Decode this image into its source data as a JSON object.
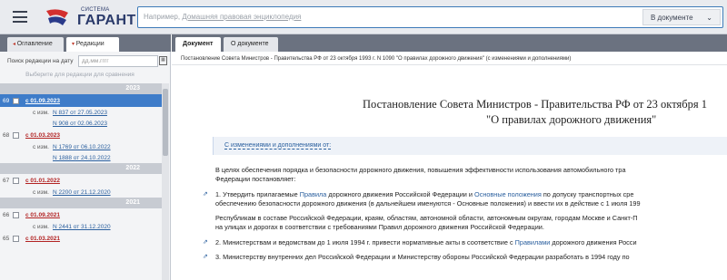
{
  "header": {
    "logo_small": "СИСТЕМА",
    "logo_big": "ГАРАНТ",
    "search_placeholder_prefix": "Например, ",
    "search_placeholder_link": "Домашняя правовая энциклопедия",
    "search_scope": "В документе"
  },
  "left_panel": {
    "tabs": [
      {
        "label": "Оглавление"
      },
      {
        "label": "Редакции"
      }
    ],
    "date_search_label": "Поиск редакции на дату",
    "date_placeholder": "дд.мм.гггг",
    "pick_hint": "Выберите для редакции для сравнения",
    "years": [
      {
        "year": "2023",
        "editions": [
          {
            "num": "69",
            "label": "с 01.09.2023",
            "changes": [
              "N 837 от 27.05.2023",
              "N 908 от 02.06.2023"
            ]
          },
          {
            "num": "68",
            "label": "с 01.03.2023",
            "changes": [
              "N 1769 от 06.10.2022",
              "N 1888 от 24.10.2022"
            ]
          }
        ]
      },
      {
        "year": "2022",
        "editions": [
          {
            "num": "67",
            "label": "с 01.01.2022",
            "changes": [
              "N 2200 от 21.12.2020"
            ]
          }
        ]
      },
      {
        "year": "2021",
        "editions": [
          {
            "num": "66",
            "label": "с 01.09.2021",
            "changes": [
              "N 2441 от 31.12.2020"
            ]
          },
          {
            "num": "65",
            "label": "с 01.03.2021",
            "changes": []
          }
        ]
      }
    ],
    "changes_prefix": "с изм."
  },
  "right_panel": {
    "tabs": [
      {
        "label": "Документ"
      },
      {
        "label": "О документе"
      }
    ],
    "breadcrumb": "Постановление Совета Министров - Правительства РФ от 23 октября 1993 г. N 1090 \"О правилах дорожного движения\" (с изменениями и дополнениями)",
    "title_line1": "Постановление Совета Министров - Правительства РФ от 23 октября 1",
    "title_line2": "\"О правилах дорожного движения\"",
    "changes_link": "С изменениями и дополнениями от:",
    "paragraphs": {
      "p1a": "В целях обеспечения порядка и безопасности дорожного движения, повышения эффективности использования автомобильного тра",
      "p1b": "Федерации постановляет:",
      "p2a_pre": "1. Утвердить прилагаемые ",
      "p2a_link1": "Правила",
      "p2a_mid": " дорожного движения Российской Федерации и ",
      "p2a_link2": "Основные положения",
      "p2a_post": " по допуску транспортных сре",
      "p2b": "обеспечению безопасности дорожного движения (в дальнейшем именуются - Основные положения) и ввести их в действие с 1 июля 199",
      "p3a": "Республикам в составе Российской Федерации, краям, областям, автономной области, автономным округам, городам Москве и Санкт-П",
      "p3b": "на улицах и дорогах в соответствии с требованиями Правил дорожного движения Российской Федерации.",
      "p4_pre": "2. Министерствам и ведомствам до 1 июля 1994 г. привести нормативные акты в соответствие с ",
      "p4_link": "Правилами",
      "p4_post": " дорожного движения Росси",
      "p5": "3. Министерству внутренних дел Российской Федерации и Министерству обороны Российской Федерации разработать в 1994 году по"
    }
  },
  "colors": {
    "accent": "#3e7cc9",
    "edition_link": "#b22222",
    "link": "#2a5f9e"
  }
}
